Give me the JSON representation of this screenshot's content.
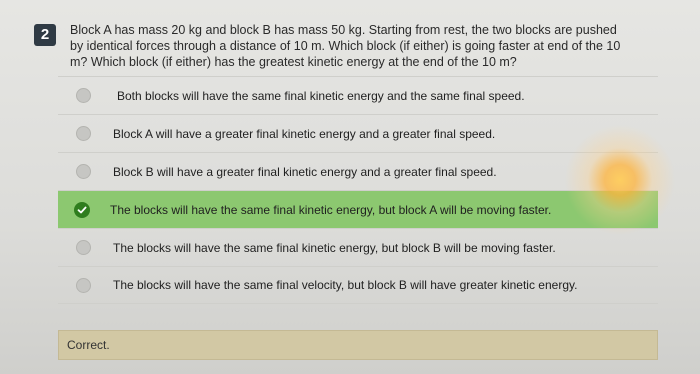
{
  "question": {
    "number": "2",
    "text": "Block A has mass 20 kg and block B has mass 50 kg. Starting from rest, the two blocks are pushed by identical forces through a distance of 10 m. Which block (if either) is going faster at end of the 10 m? Which block (if either) has the greatest kinetic energy at the end of the 10 m?"
  },
  "options": [
    {
      "label": "Both blocks will have the same final kinetic energy and the same final speed."
    },
    {
      "label": "Block A will have a greater final kinetic energy and a greater final speed."
    },
    {
      "label": "Block B will have a greater final kinetic energy and a greater final speed."
    },
    {
      "label": "The blocks will have the same final kinetic energy, but block A will be moving faster."
    },
    {
      "label": "The blocks will have the same final kinetic energy, but block B will be moving faster."
    },
    {
      "label": "The blocks will have the same final velocity, but block B will have greater kinetic energy."
    }
  ],
  "feedback": {
    "text": "Correct."
  },
  "colors": {
    "selected_bg": "#8cc870",
    "check": "#2f7d1e",
    "number_badge": "#2f3a44"
  }
}
